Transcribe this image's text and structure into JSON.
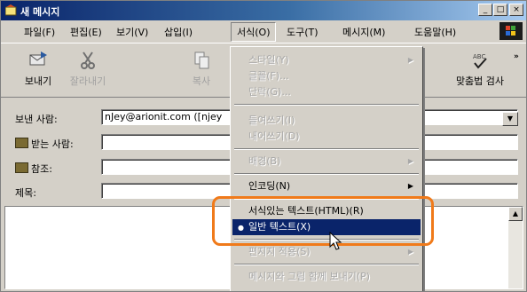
{
  "window": {
    "title": "새 메시지",
    "buttons": {
      "minimize": "_",
      "maximize": "□",
      "close": "×"
    }
  },
  "menubar": {
    "items": [
      {
        "label": "파일(F)"
      },
      {
        "label": "편집(E)"
      },
      {
        "label": "보기(V)"
      },
      {
        "label": "삽입(I)"
      },
      {
        "label": "서식(O)",
        "active": true
      },
      {
        "label": "도구(T)"
      },
      {
        "label": "메시지(M)"
      },
      {
        "label": "도움말(H)"
      }
    ]
  },
  "toolbar": {
    "send": {
      "label": "보내기",
      "icon": "send-icon"
    },
    "cut": {
      "label": "잘라내기",
      "icon": "scissors-icon"
    },
    "copy": {
      "label": "복사",
      "icon": "copy-icon"
    },
    "spell": {
      "label": "맞춤법 검사",
      "icon": "spellcheck-icon"
    },
    "overflow": "»"
  },
  "fields": {
    "from_label": "보낸 사람:",
    "from_value": "nJey@arionit.com  ([njey",
    "to_label": "받는 사람:",
    "to_value": "",
    "cc_label": "참조:",
    "cc_value": "",
    "subject_label": "제목:",
    "subject_value": ""
  },
  "format_menu": {
    "items": [
      {
        "label": "스타일(Y)",
        "disabled": true,
        "submenu": true
      },
      {
        "label": "글꼴(F)...",
        "disabled": true
      },
      {
        "label": "단락(G)...",
        "disabled": true
      },
      {
        "label": "들여쓰기(I)",
        "disabled": true
      },
      {
        "label": "내어쓰기(D)",
        "disabled": true
      },
      {
        "label": "배경(B)",
        "disabled": true,
        "submenu": true
      },
      {
        "label": "인코딩(N)",
        "disabled": false,
        "submenu": true
      },
      {
        "label": "서식있는 텍스트(HTML)(R)",
        "disabled": false
      },
      {
        "label": "일반 텍스트(X)",
        "disabled": false,
        "checked": true,
        "selected": true
      },
      {
        "label": "편지지 적용(S)",
        "disabled": true,
        "submenu": true
      },
      {
        "label": "메시지와 그림 함께 보내기(P)",
        "disabled": true
      }
    ],
    "check_mark": "●",
    "submenu_arrow": "▶"
  },
  "colors": {
    "titlebar_start": "#0a246a",
    "titlebar_end": "#a6caf0",
    "selection": "#0a246a",
    "highlight_ring": "#f07a1a",
    "chrome": "#d4d0c8"
  }
}
